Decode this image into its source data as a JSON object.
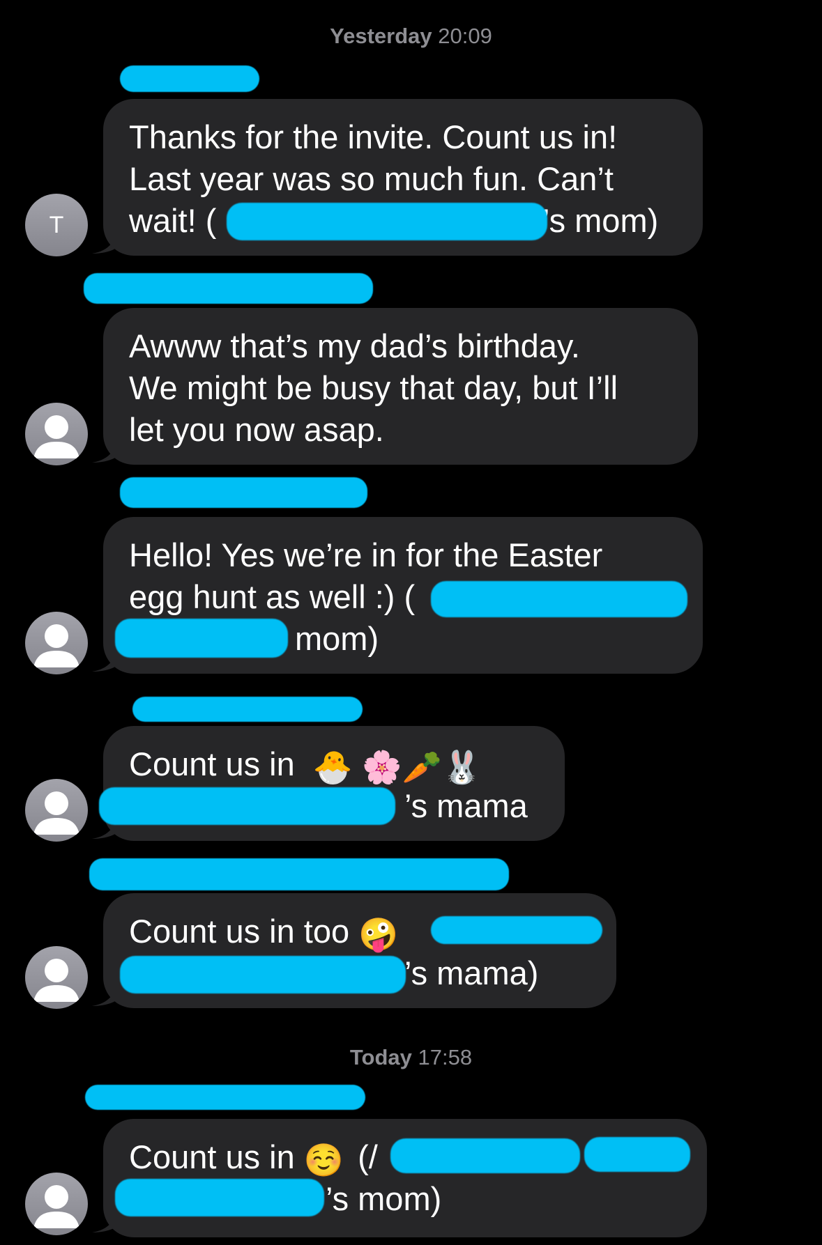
{
  "timestamps": {
    "yesterday": {
      "day": "Yesterday",
      "time": " 20:09"
    },
    "today": {
      "day": "Today",
      "time": " 17:58"
    }
  },
  "messages": [
    {
      "avatar_initial": "T",
      "lines": [
        "Thanks for the invite. Count us in!",
        "Last year was so much fun. Can’t",
        "wait! ("
      ],
      "line3_suffix": "’s mom)"
    },
    {
      "lines": [
        "Awww that’s my dad’s birthday.",
        "We might be busy that day, but I’ll",
        "let you now asap."
      ]
    },
    {
      "lines": [
        "Hello! Yes we’re in for the Easter",
        "egg hunt as well :) (",
        "mom)"
      ]
    },
    {
      "lines": [
        "Count us in  ",
        "’s mama"
      ],
      "emojis": [
        "🐣",
        "🌸",
        "🥕",
        "🐰"
      ]
    },
    {
      "lines": [
        "Count us in too ",
        "’s mama)"
      ],
      "emojis": [
        "🤪"
      ]
    },
    {
      "lines": [
        "Count us in ",
        "’s mom)"
      ],
      "emojis": [
        "☺️"
      ],
      "open_paren": "(/"
    }
  ],
  "colors": {
    "background": "#000000",
    "bubble": "#262628",
    "redaction": "#00bff5",
    "timestamp": "#8e8e93",
    "avatar": "#9a9aa1"
  },
  "icons": {
    "default_avatar": "person-silhouette-icon"
  }
}
